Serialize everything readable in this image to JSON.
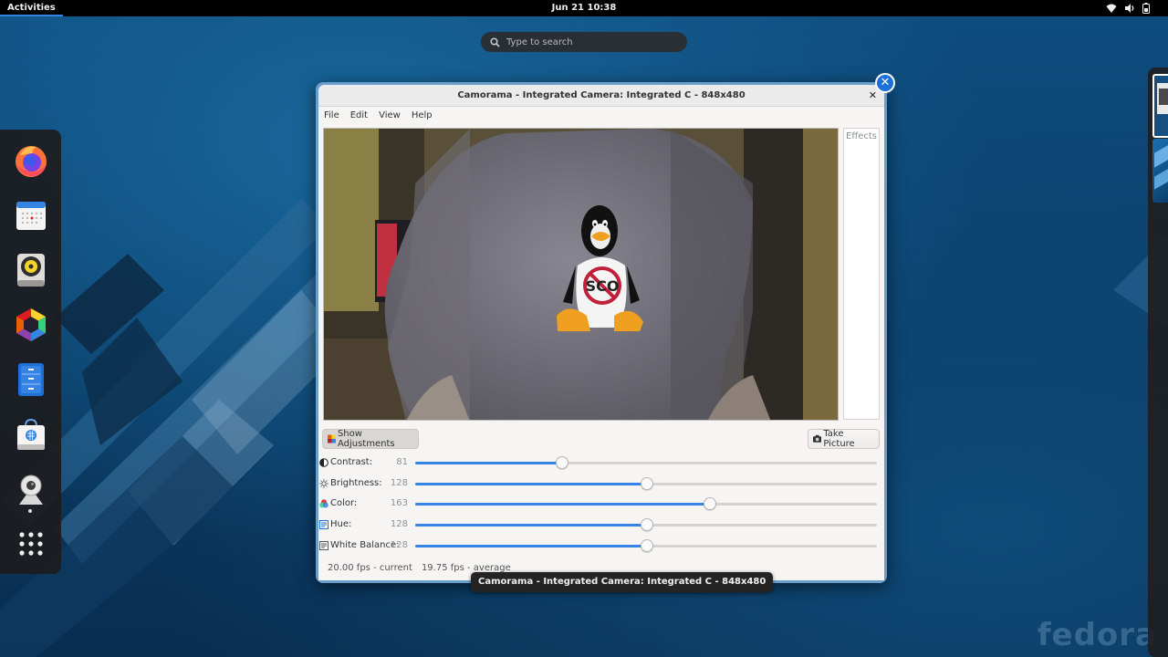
{
  "topbar": {
    "activities": "Activities",
    "clock": "Jun 21  10:38",
    "tray_icons": [
      "wifi-icon",
      "volume-icon",
      "battery-icon"
    ]
  },
  "search": {
    "placeholder": "Type to search"
  },
  "dash": {
    "apps": [
      {
        "name": "firefox-icon"
      },
      {
        "name": "calendar-icon"
      },
      {
        "name": "rhythmbox-icon"
      },
      {
        "name": "software-center-icon"
      },
      {
        "name": "files-icon"
      },
      {
        "name": "software-store-icon"
      },
      {
        "name": "camorama-webcam-icon",
        "running": true
      },
      {
        "name": "show-apps-grid-icon"
      }
    ]
  },
  "window": {
    "title": "Camorama - Integrated Camera: Integrated C - 848x480",
    "menu": [
      "File",
      "Edit",
      "View",
      "Help"
    ],
    "effects_label": "Effects",
    "show_adjustments": "Show Adjustments",
    "take_picture": "Take Picture",
    "adjustments": [
      {
        "label": "Contrast:",
        "value": 81,
        "max": 255,
        "icon": "contrast-icon"
      },
      {
        "label": "Brightness:",
        "value": 128,
        "max": 255,
        "icon": "brightness-icon"
      },
      {
        "label": "Color:",
        "value": 163,
        "max": 255,
        "icon": "color-icon"
      },
      {
        "label": "Hue:",
        "value": 128,
        "max": 255,
        "icon": "hue-icon"
      },
      {
        "label": "White Balance:",
        "value": 128,
        "max": 255,
        "icon": "white-balance-icon"
      }
    ],
    "fps_current": "20.00 fps - current",
    "fps_average": "19.75 fps - average",
    "camera_image_text": "SCO"
  },
  "tooltip": "Camorama - Integrated Camera: Integrated C - 848x480",
  "watermark": "fedora",
  "colors": {
    "accent": "#3584e4",
    "panel": "#000000",
    "window_bg": "#f6f5f4"
  }
}
